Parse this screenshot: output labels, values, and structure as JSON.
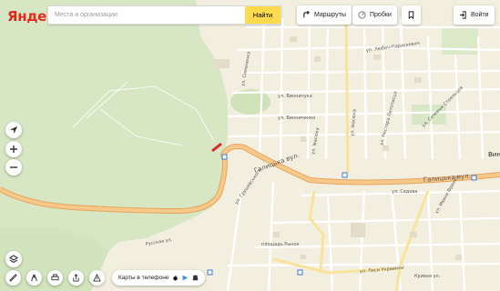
{
  "header": {
    "logo": "Яндекс",
    "search_placeholder": "Места и организации",
    "find_label": "Найти",
    "routes_label": "Маршруты",
    "traffic_label": "Пробки",
    "login_label": "Войти"
  },
  "footer": {
    "apps_label": "Карты в телефоне"
  },
  "map": {
    "street_labels": [
      "Галицька вул.",
      "Галицька вул.",
      "ул. Винничука",
      "ул. Винниченко",
      "ул. Івасюка",
      "ул. Івасюка",
      "ул. Любич-Параскевич",
      "ул. Грушевського",
      "Русская ул.",
      "площадь Рынок",
      "ул. Седова",
      "ул. Ивана Франко",
      "ул. Леси Украинки",
      "ул. Симоненка",
      "ул. Нестора Летописца",
      "ул. Сечевых Стрельцов",
      "Кривая ул.",
      "Вин"
    ]
  },
  "colors": {
    "brand_red": "#e02a20",
    "find_button": "#ffdb4d",
    "main_road": "#f6c98a",
    "forest": "#d7e7c4",
    "urban": "#f3efe0"
  }
}
